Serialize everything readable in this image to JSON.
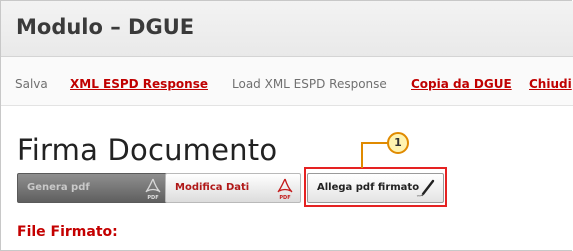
{
  "header": {
    "title": "Modulo – DGUE"
  },
  "toolbar": {
    "items": [
      {
        "label": "Salva",
        "style": "plain"
      },
      {
        "label": "XML ESPD Response",
        "style": "link"
      },
      {
        "label": "Load XML ESPD Response",
        "style": "plain"
      },
      {
        "label": "Copia da DGUE",
        "style": "link"
      },
      {
        "label": "Chiudi",
        "style": "link"
      }
    ]
  },
  "page": {
    "title": "Firma Documento",
    "buttons": {
      "genera": {
        "label": "Genera pdf",
        "icon": "pdf-icon",
        "enabled": false
      },
      "modifica": {
        "label": "Modifica Dati",
        "icon": "pdf-icon"
      },
      "allega": {
        "label": "Allega pdf firmato",
        "icon": "pen-icon"
      }
    },
    "pdf_icon_text": "PDF",
    "section_label": "File Firmato:"
  },
  "annotation": {
    "badge": "1",
    "highlight_color": "#e52222",
    "badge_border_color": "#e08a00"
  },
  "colors": {
    "accent_red": "#c00000",
    "header_bg": "#efefef"
  }
}
